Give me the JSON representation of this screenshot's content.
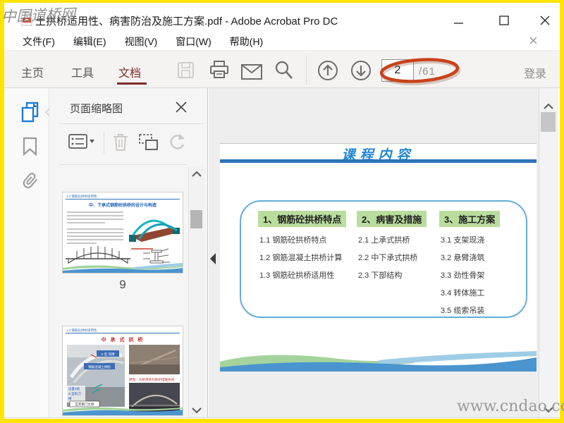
{
  "window": {
    "title": "土拱桥适用性、病害防治及施工方案.pdf - Adobe Acrobat Pro DC"
  },
  "watermarks": {
    "top_left": "中国道桥网",
    "bottom_right": "www.cndao.com"
  },
  "menu": {
    "items": [
      "文件(F)",
      "编辑(E)",
      "视图(V)",
      "窗口(W)",
      "帮助(H)"
    ]
  },
  "toolbar": {
    "tabs": [
      {
        "label": "主页"
      },
      {
        "label": "工具"
      },
      {
        "label": "文档"
      }
    ],
    "page_number": "2",
    "page_total": "/61",
    "sign_in_label": "登录"
  },
  "left_panel": {
    "title": "页面缩略图",
    "thumbnails": [
      {
        "header": "1.3 钢筋砼拱桥适用性",
        "slide_title": "中、下承式钢筋砼拱桥的设计与构造",
        "page_label": "9"
      },
      {
        "header": "1.3 钢筋砼拱桥适用性",
        "slide_title": "中 承 式 拱 桥",
        "labels": {
          "wind_brace": "X 型 风撑",
          "arch_rib": "钢筋混凝土拱肋",
          "note_line1": "设置3道",
          "note_line2": "X 型剪刀",
          "note_line3": "撑",
          "bridge_name": "宜宾南门大桥",
          "cause": "原因：大桥吊杆的防护措施失效"
        }
      }
    ]
  },
  "document": {
    "slide": {
      "title": "课程内容",
      "columns": [
        {
          "header": "1、钢筋砼拱桥特点",
          "items": [
            "1.1 钢筋砼拱桥特点",
            "1.2 钢筋混凝土拱桥计算",
            "1.3 钢筋砼拱桥适用性"
          ]
        },
        {
          "header": "2、病害及措施",
          "items": [
            "2.1 上承式拱桥",
            "2.2 中下承式拱桥",
            "2.3 下部结构"
          ]
        },
        {
          "header": "3、施工方案",
          "items": [
            "3.1 支架现浇",
            "3.2 悬臂浇筑",
            "3.3 劲性骨架",
            "3.4 转体施工",
            "3.5 缆索吊装"
          ]
        }
      ]
    }
  },
  "colors": {
    "frame_border": "#ffe400",
    "tab_active": "#7b2d28",
    "annotation_ellipse": "#c8431c",
    "slide_rule_blue": "#2e74b8",
    "slide_title_blue": "#1e86d6",
    "column_header_green": "#b9dd9d",
    "box_border_blue": "#62adda",
    "wave_green": "#a5d39e",
    "wave_blue": "#4a94cf",
    "sidebar_active_blue": "#1a7cd8"
  }
}
